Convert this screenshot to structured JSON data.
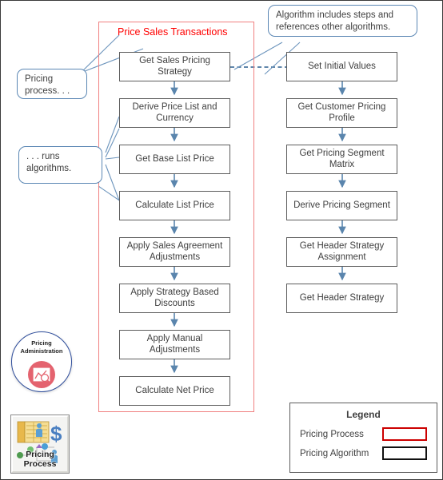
{
  "diagram": {
    "process": {
      "title": "Price Sales Transactions",
      "border_color": "#f08080",
      "title_color": "#ff0000"
    },
    "left_column": [
      {
        "label": "Get Sales Pricing Strategy"
      },
      {
        "label": "Derive  Price List and Currency"
      },
      {
        "label": "Get Base List Price"
      },
      {
        "label": "Calculate List Price"
      },
      {
        "label": "Apply Sales Agreement Adjustments"
      },
      {
        "label": "Apply Strategy  Based Discounts"
      },
      {
        "label": "Apply Manual Adjustments"
      },
      {
        "label": "Calculate Net Price"
      }
    ],
    "right_column": [
      {
        "label": "Set Initial Values"
      },
      {
        "label": "Get Customer Pricing Profile"
      },
      {
        "label": "Get Pricing Segment Matrix"
      },
      {
        "label": "Derive  Pricing Segment"
      },
      {
        "label": "Get Header Strategy Assignment"
      },
      {
        "label": "Get Header  Strategy"
      }
    ],
    "callouts": [
      {
        "text": "Pricing process. . ."
      },
      {
        "text": ". . . runs algorithms."
      },
      {
        "text": "Algorithm includes steps and references other algorithms."
      }
    ],
    "legend": {
      "title": "Legend",
      "rows": [
        {
          "label": "Pricing Process",
          "color": "#cc0000"
        },
        {
          "label": "Pricing Algorithm",
          "color": "#111111"
        }
      ]
    },
    "badges": {
      "admin": {
        "line1": "Pricing",
        "line2": "Administration"
      },
      "process_icon": {
        "line1": "Pricing",
        "line2": "Process"
      }
    },
    "colors": {
      "node_border": "#5c5c5c",
      "arrow": "#5a85ad",
      "callout_border": "#5b87b4"
    }
  }
}
